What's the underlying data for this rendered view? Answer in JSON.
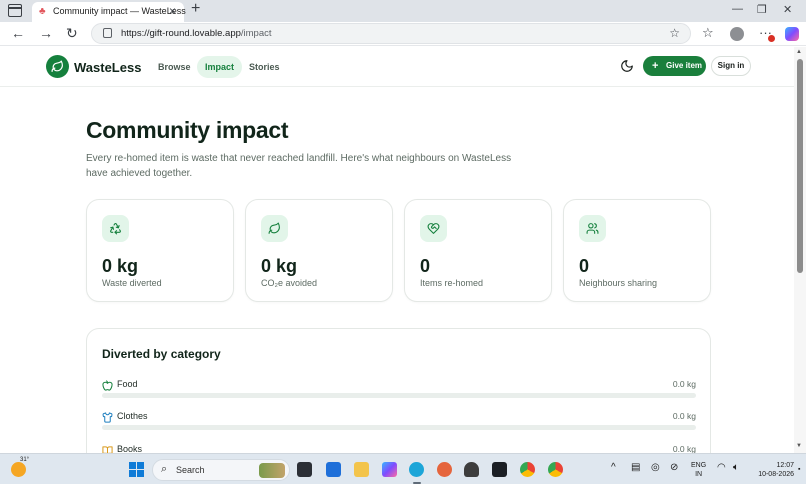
{
  "browser": {
    "tab_title": "Community impact — WasteLess",
    "url_host": "https://gift-round.lovable.app",
    "url_path": "/impact"
  },
  "header": {
    "brand": "WasteLess",
    "nav": [
      {
        "label": "Browse",
        "active": false
      },
      {
        "label": "Impact",
        "active": true
      },
      {
        "label": "Stories",
        "active": false
      }
    ],
    "give_button": "Give item",
    "sign_in_button": "Sign in"
  },
  "hero": {
    "title": "Community impact",
    "subtitle": "Every re-homed item is waste that never reached landfill. Here's what neighbours on WasteLess have achieved together."
  },
  "stats": [
    {
      "icon": "recycle-icon",
      "value": "0 kg",
      "label": "Waste diverted"
    },
    {
      "icon": "leaf-icon",
      "value": "0 kg",
      "label": "CO₂e avoided"
    },
    {
      "icon": "heart-handshake-icon",
      "value": "0",
      "label": "Items re-homed"
    },
    {
      "icon": "users-icon",
      "value": "0",
      "label": "Neighbours sharing"
    }
  ],
  "categories": {
    "title": "Diverted by category",
    "items": [
      {
        "icon": "apple-icon",
        "name": "Food",
        "value": "0.0 kg",
        "fraction": 0
      },
      {
        "icon": "shirt-icon",
        "name": "Clothes",
        "value": "0.0 kg",
        "fraction": 0
      },
      {
        "icon": "book-icon",
        "name": "Books",
        "value": "0.0 kg",
        "fraction": 0
      }
    ]
  },
  "taskbar": {
    "weather_temp": "31°",
    "search_placeholder": "Search",
    "lang_top": "ENG",
    "lang_bottom": "IN",
    "time": "12:07",
    "date": "10-08-2026"
  },
  "colors": {
    "brand_green": "#15803d",
    "icon_bg": "#e2f5e9",
    "active_nav_bg": "#e4f5ea"
  }
}
